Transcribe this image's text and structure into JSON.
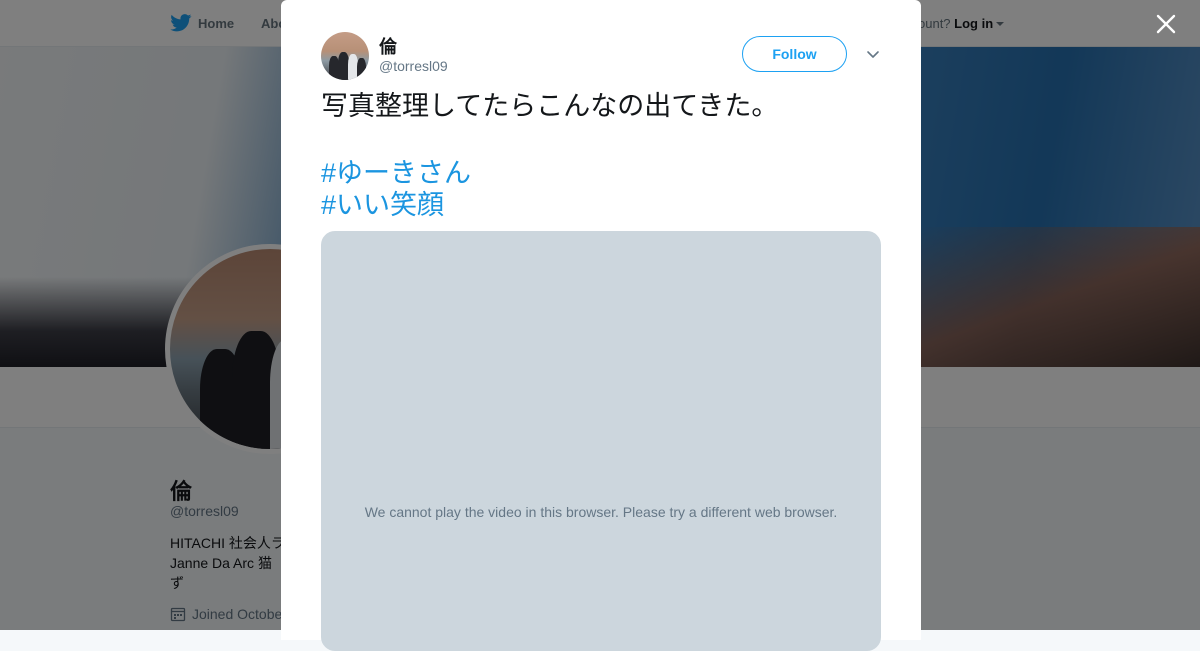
{
  "header": {
    "home_label": "Home",
    "about_label": "Abo",
    "account_prompt": "ccount?",
    "login_label": "Log in"
  },
  "profile": {
    "name": "倫",
    "handle": "@torresl09",
    "bio_lines": [
      "HITACHI 社会人ラ",
      "Janne Da Arc 猫 ",
      "ず"
    ],
    "joined": "Joined Octobe"
  },
  "tweet": {
    "author_name": "倫",
    "author_handle": "@torresl09",
    "follow_label": "Follow",
    "text": "写真整理してたらこんなの出てきた。",
    "hashtags": [
      "#ゆーきさん",
      "#いい笑顔"
    ],
    "video_message": "We cannot play the video in this browser. Please try a different web browser."
  },
  "icons": {
    "logo": "twitter-bird-icon",
    "close": "close-icon",
    "more": "chevron-down-icon",
    "calendar": "calendar-icon"
  },
  "colors": {
    "accent": "#1da1f2",
    "hashtag": "#1b95e0",
    "secondary_text": "#657786",
    "video_bg": "#ccd6dd"
  }
}
